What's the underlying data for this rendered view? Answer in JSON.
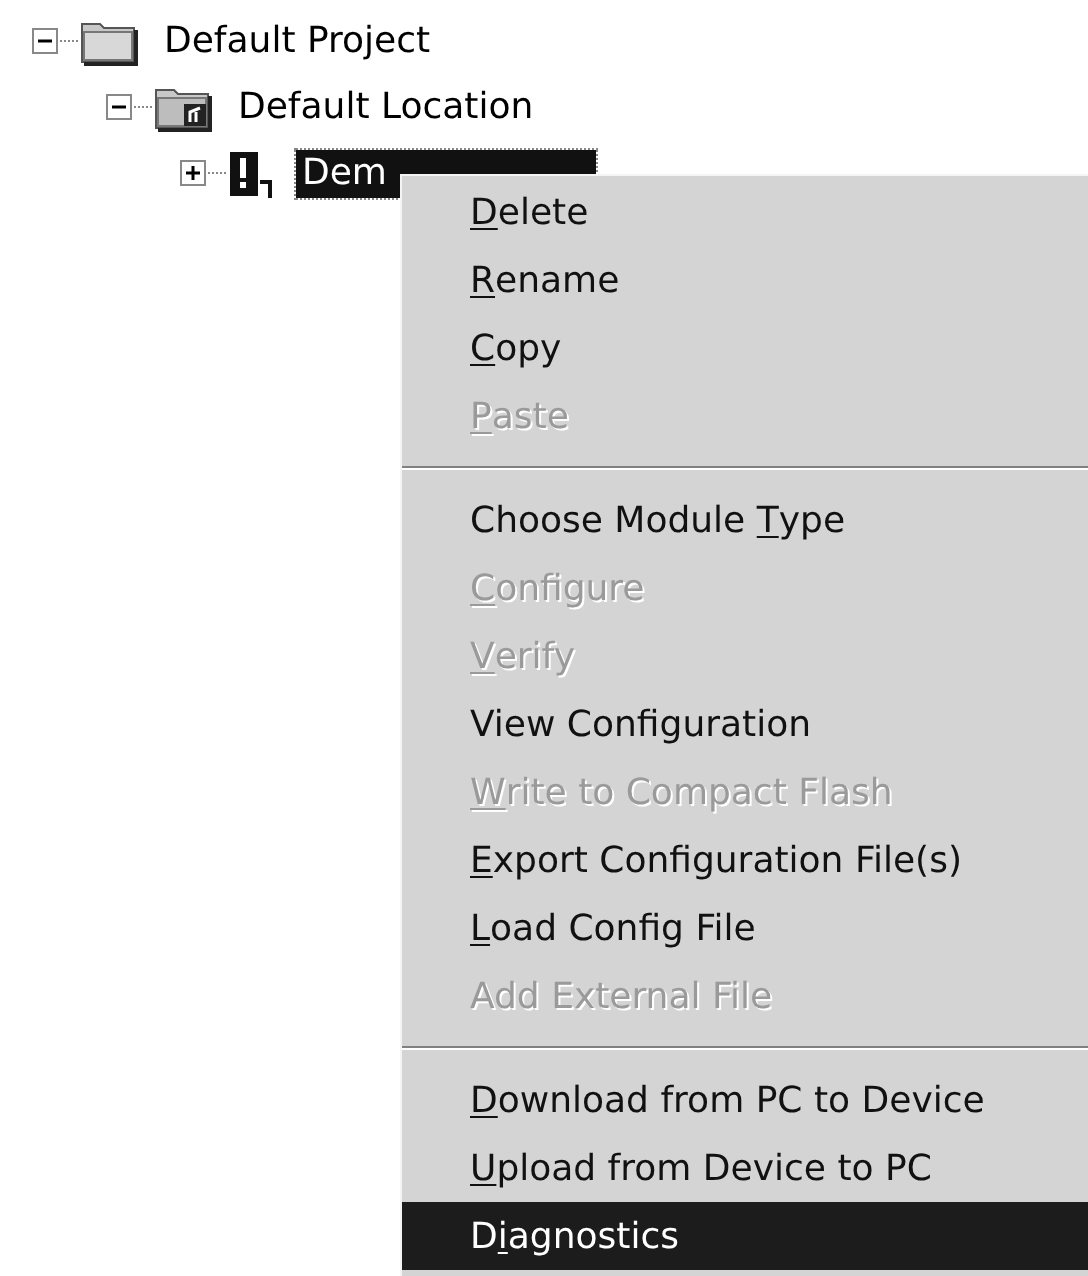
{
  "tree": [
    {
      "label": "Default Project",
      "expanded": true,
      "kind": "folder",
      "selected": false,
      "children": [
        {
          "label": "Default Location",
          "expanded": true,
          "kind": "location",
          "selected": false,
          "children": [
            {
              "label": "Dem",
              "expanded": false,
              "kind": "module",
              "selected": true
            }
          ]
        }
      ]
    }
  ],
  "context_menu": {
    "items": [
      {
        "kind": "item",
        "key": "D",
        "after": "elete",
        "disabled": false,
        "selected": false
      },
      {
        "kind": "item",
        "key": "R",
        "after": "ename",
        "disabled": false,
        "selected": false
      },
      {
        "kind": "item",
        "key": "C",
        "after": "opy",
        "disabled": false,
        "selected": false
      },
      {
        "kind": "item",
        "key": "P",
        "after": "aste",
        "disabled": true,
        "selected": false
      },
      {
        "kind": "separator"
      },
      {
        "kind": "item",
        "before": "Choose Module ",
        "key": "T",
        "after": "ype",
        "disabled": false,
        "selected": false
      },
      {
        "kind": "item",
        "key": "C",
        "after": "onfigure",
        "disabled": true,
        "selected": false
      },
      {
        "kind": "item",
        "key": "V",
        "after": "erify",
        "disabled": true,
        "selected": false
      },
      {
        "kind": "item",
        "before": "View Configuration",
        "disabled": false,
        "selected": false
      },
      {
        "kind": "item",
        "key": "W",
        "after": "rite to Compact Flash",
        "disabled": true,
        "selected": false
      },
      {
        "kind": "item",
        "key": "E",
        "after": "xport Configuration File(s)",
        "disabled": false,
        "selected": false
      },
      {
        "kind": "item",
        "key": "L",
        "after": "oad Config File",
        "disabled": false,
        "selected": false
      },
      {
        "kind": "item",
        "before": "Add External File",
        "disabled": true,
        "selected": false
      },
      {
        "kind": "separator"
      },
      {
        "kind": "item",
        "key": "D",
        "after": "ownload from PC to Device",
        "disabled": false,
        "selected": false
      },
      {
        "kind": "item",
        "key": "U",
        "after": "pload from Device to PC",
        "disabled": false,
        "selected": false
      },
      {
        "kind": "item",
        "before": "D",
        "key": "i",
        "after": "agnostics",
        "disabled": false,
        "selected": true
      }
    ]
  }
}
